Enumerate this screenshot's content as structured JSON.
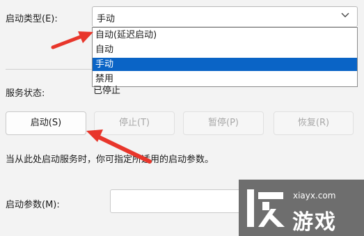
{
  "startup_type": {
    "label": "启动类型(E):",
    "selected": "手动",
    "options": [
      "自动(延迟启动)",
      "自动",
      "手动",
      "禁用"
    ]
  },
  "service_status": {
    "label": "服务状态:",
    "value": "已停止"
  },
  "buttons": {
    "start": "启动(S)",
    "stop": "停止(T)",
    "pause": "暂停(P)",
    "resume": "恢复(R)"
  },
  "hint": "当从此处启动服务时，你可指定所适用的启动参数。",
  "start_params": {
    "label": "启动参数(M):",
    "value": ""
  },
  "watermark": {
    "site": "xiayx.com",
    "name": "游戏"
  },
  "colors": {
    "arrow": "#e8362b",
    "selection": "#0a64c6"
  }
}
